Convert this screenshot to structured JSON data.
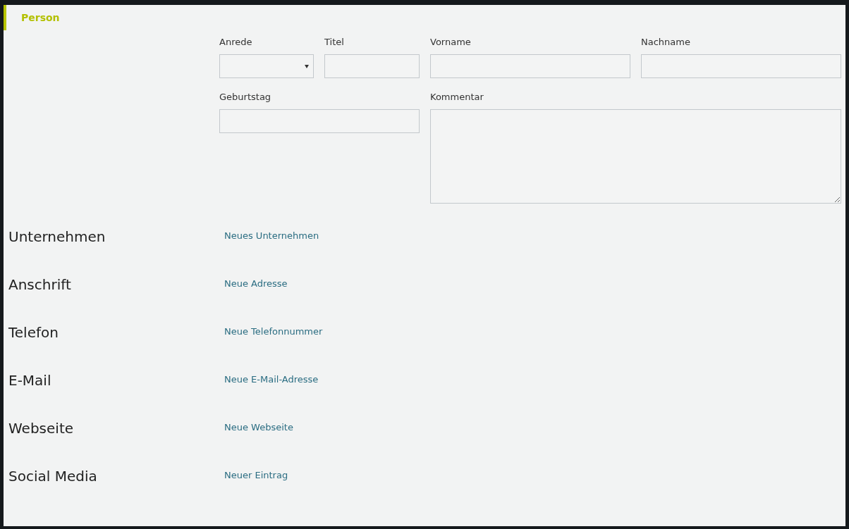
{
  "section": {
    "title": "Person"
  },
  "fields": [
    {
      "label": "Anrede",
      "kind": "select"
    },
    {
      "label": "Titel",
      "kind": "text"
    },
    {
      "label": "Vorname",
      "kind": "text"
    },
    {
      "label": "Nachname",
      "kind": "text"
    },
    {
      "label": "Geburtstag",
      "kind": "text"
    },
    {
      "label": "Kommentar",
      "kind": "textarea"
    }
  ],
  "groups": [
    {
      "heading": "Unternehmen",
      "link": "Neues Unternehmen"
    },
    {
      "heading": "Anschrift",
      "link": "Neue Adresse"
    },
    {
      "heading": "Telefon",
      "link": "Neue Telefonnummer"
    },
    {
      "heading": "E-Mail",
      "link": "Neue E-Mail-Adresse"
    },
    {
      "heading": "Webseite",
      "link": "Neue Webseite"
    },
    {
      "heading": "Social Media",
      "link": "Neuer Eintrag"
    }
  ]
}
